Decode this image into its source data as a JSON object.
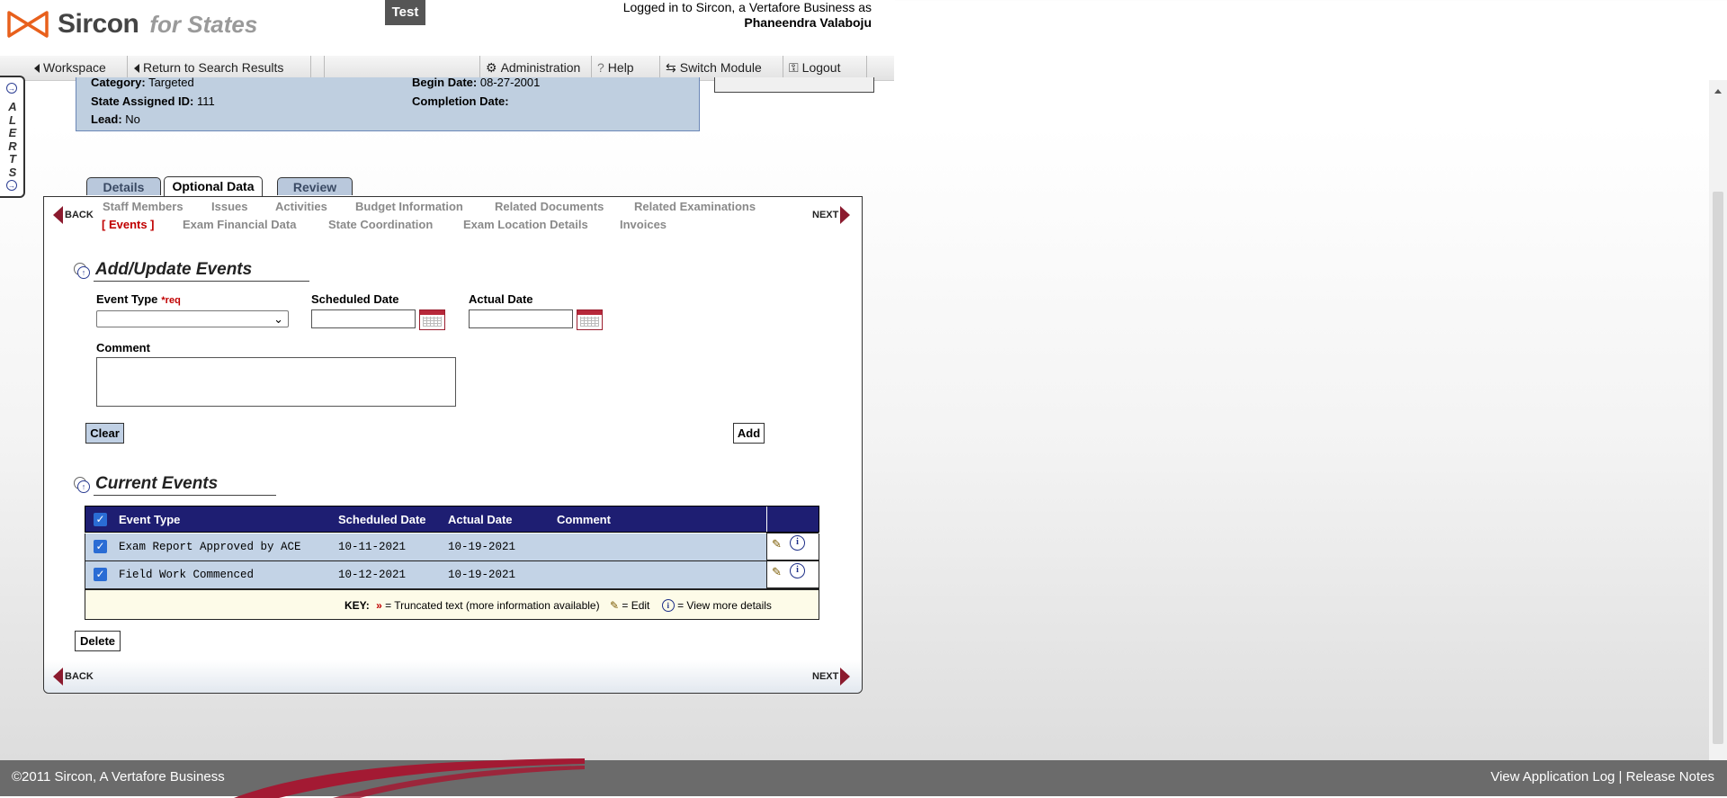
{
  "header": {
    "brand": "Sircon",
    "brand_sub": "for States",
    "environment": "Test",
    "login_text": "Logged in to Sircon, a Vertafore Business as",
    "user_name": "Phaneendra Valaboju"
  },
  "navbar": {
    "workspace": "Workspace",
    "return": "Return to Search Results",
    "administration": "Administration",
    "help": "Help",
    "switch_module": "Switch Module",
    "logout": "Logout"
  },
  "alerts": {
    "letters": [
      "A",
      "L",
      "E",
      "R",
      "T",
      "S"
    ]
  },
  "summary": {
    "category_label": "Category:",
    "category_value": "Targeted",
    "state_id_label": "State Assigned ID:",
    "state_id_value": "111",
    "lead_label": "Lead:",
    "lead_value": "No",
    "begin_label": "Begin Date:",
    "begin_value": "08-27-2001",
    "completion_label": "Completion Date:",
    "completion_value": ""
  },
  "tabs": [
    "Details",
    "Optional Data",
    "Review"
  ],
  "active_tab": "Optional Data",
  "subnav": {
    "back": "BACK",
    "next": "NEXT",
    "row1": [
      "Staff Members",
      "Issues",
      "Activities",
      "Budget Information",
      "Related Documents",
      "Related Examinations"
    ],
    "current": "[ Events ]",
    "row2": [
      "Exam Financial Data",
      "State Coordination",
      "Exam Location Details",
      "Invoices"
    ]
  },
  "add_section": {
    "title": "Add/Update Events",
    "event_type_label": "Event Type",
    "req_label": "*req",
    "event_type_value": "",
    "scheduled_label": "Scheduled Date",
    "scheduled_value": "",
    "actual_label": "Actual Date",
    "actual_value": "",
    "comment_label": "Comment",
    "comment_value": "",
    "clear_button": "Clear",
    "add_button": "Add"
  },
  "current_section": {
    "title": "Current Events",
    "columns": [
      "Event Type",
      "Scheduled Date",
      "Actual Date",
      "Comment"
    ],
    "rows": [
      {
        "event_type": "Exam Report Approved by ACE",
        "scheduled": "10-11-2021",
        "actual": "10-19-2021",
        "comment": "",
        "checked": true
      },
      {
        "event_type": "Field Work Commenced",
        "scheduled": "10-12-2021",
        "actual": "10-19-2021",
        "comment": "",
        "checked": true
      }
    ],
    "key_label": "KEY:",
    "key_truncated_symbol": "»",
    "key_truncated": "= Truncated text (more information available)",
    "key_edit": "= Edit",
    "key_view": "= View more details",
    "delete_button": "Delete"
  },
  "footer": {
    "copyright": "©2011 Sircon, A Vertafore Business",
    "links": "View Application Log | Release Notes"
  },
  "colors": {
    "brand_orange": "#e8601c",
    "table_header": "#1e1e72",
    "row_blue": "#c3d3e6",
    "accent_red": "#8b1a2e",
    "current_link": "#c00000"
  }
}
